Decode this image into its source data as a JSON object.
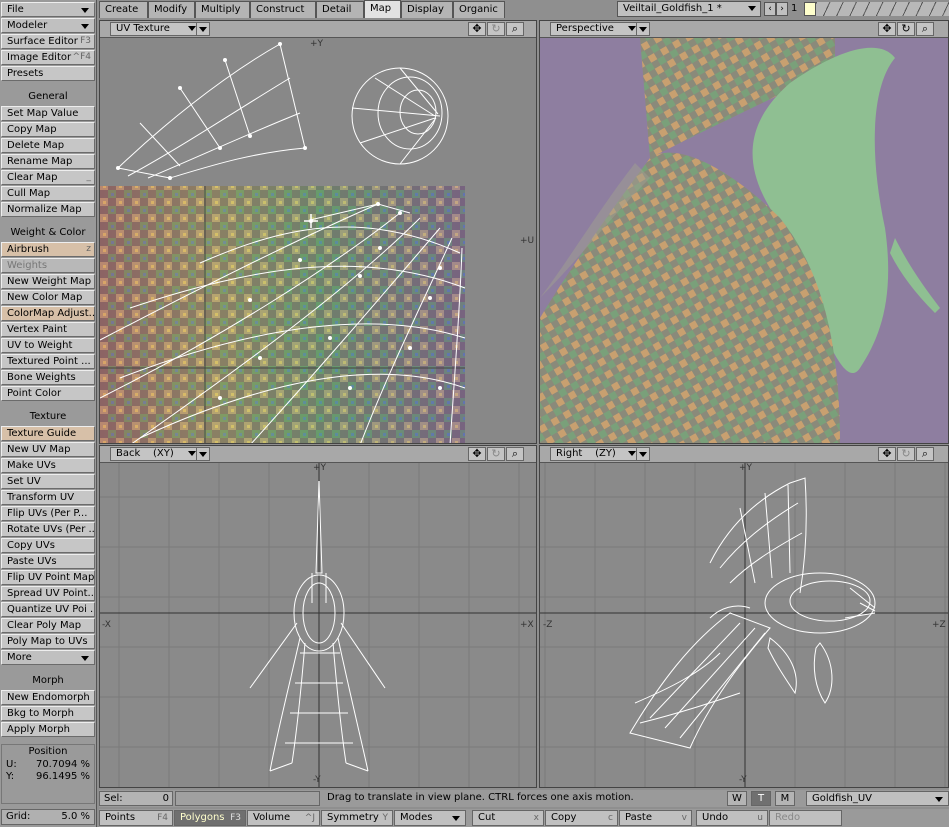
{
  "left": {
    "file": "File",
    "modeler": "Modeler",
    "items": [
      {
        "label": "Surface Editor",
        "sc": "F3"
      },
      {
        "label": "Image Editor",
        "sc": "^F4"
      },
      {
        "label": "Presets",
        "sc": ""
      }
    ],
    "general": "General",
    "general_items": [
      {
        "label": "Set Map Value",
        "sc": ""
      },
      {
        "label": "Copy Map",
        "sc": ""
      },
      {
        "label": "Delete Map",
        "sc": ""
      },
      {
        "label": "Rename Map",
        "sc": ""
      },
      {
        "label": "Clear Map",
        "sc": "_"
      },
      {
        "label": "Cull Map",
        "sc": ""
      },
      {
        "label": "Normalize Map",
        "sc": ""
      }
    ],
    "weight": "Weight & Color",
    "weight_items": [
      {
        "label": "Airbrush",
        "sc": "z"
      },
      {
        "label": "Weights",
        "sc": ""
      },
      {
        "label": "New Weight Map",
        "sc": ""
      },
      {
        "label": "New Color Map",
        "sc": ""
      },
      {
        "label": "ColorMap Adjust...",
        "sc": ""
      },
      {
        "label": "Vertex Paint",
        "sc": ""
      },
      {
        "label": "UV to Weight",
        "sc": ""
      },
      {
        "label": "Textured Point ...",
        "sc": ""
      },
      {
        "label": "Bone Weights",
        "sc": ""
      },
      {
        "label": "Point Color",
        "sc": ""
      }
    ],
    "texture": "Texture",
    "texture_items": [
      {
        "label": "Texture Guide",
        "sc": ""
      },
      {
        "label": "New UV Map",
        "sc": ""
      },
      {
        "label": "Make UVs",
        "sc": ""
      },
      {
        "label": "Set UV",
        "sc": ""
      },
      {
        "label": "Transform UV",
        "sc": ""
      },
      {
        "label": "Flip UVs (Per P...",
        "sc": ""
      },
      {
        "label": "Rotate UVs (Per ...",
        "sc": ""
      },
      {
        "label": "Copy UVs",
        "sc": ""
      },
      {
        "label": "Paste UVs",
        "sc": ""
      },
      {
        "label": "Flip UV Point Map",
        "sc": ""
      },
      {
        "label": "Spread UV Point...",
        "sc": ""
      },
      {
        "label": "Quantize UV Poi ...",
        "sc": ""
      },
      {
        "label": "Clear Poly Map",
        "sc": ""
      },
      {
        "label": "Poly Map to UVs",
        "sc": ""
      }
    ],
    "more": "More",
    "morph": "Morph",
    "morph_items": [
      {
        "label": "New Endomorph",
        "sc": ""
      },
      {
        "label": "Bkg to Morph",
        "sc": ""
      },
      {
        "label": "Apply Morph",
        "sc": ""
      }
    ],
    "position_title": "Position",
    "u_label": "U:",
    "u_value": "70.7094 %",
    "v_label": "Y:",
    "v_value": "96.1495 %",
    "grid_label": "Grid:",
    "grid_value": "5.0 %"
  },
  "tabs": [
    "Create",
    "Modify",
    "Multiply",
    "Construct",
    "Detail",
    "Map",
    "Display",
    "Organic"
  ],
  "active_tab": "Map",
  "document": "Veiltail_Goldfish_1 *",
  "layer_num": "1",
  "viewports": {
    "tl": {
      "label": "UV Texture",
      "axis_top": "+Y",
      "axis_right": "+U"
    },
    "tr": {
      "label": "Perspective"
    },
    "bl": {
      "label": "Back",
      "view": "(XY)",
      "axis_top": "+Y",
      "axis_bottom": "-Y",
      "axis_left": "-X",
      "axis_right": "+X"
    },
    "br": {
      "label": "Right",
      "view": "(ZY)",
      "axis_top": "+Y",
      "axis_bottom": "-Y",
      "axis_left": "-Z",
      "axis_right": "+Z"
    }
  },
  "status": {
    "sel_label": "Sel:",
    "sel_value": "0",
    "message": "Drag to translate in view plane. CTRL forces one axis motion.",
    "w": "W",
    "t": "T",
    "m": "M",
    "map": "Goldfish_UV"
  },
  "toolbar": [
    {
      "label": "Points",
      "sc": "F4"
    },
    {
      "label": "Polygons",
      "sc": "F3"
    },
    {
      "label": "Volume",
      "sc": "^J"
    },
    {
      "label": "Symmetry",
      "sc": "Y"
    },
    {
      "label": "Modes",
      "sc": ""
    },
    {
      "label": "Cut",
      "sc": "x"
    },
    {
      "label": "Copy",
      "sc": "c"
    },
    {
      "label": "Paste",
      "sc": "v"
    },
    {
      "label": "Undo",
      "sc": "u"
    },
    {
      "label": "Redo",
      "sc": ""
    }
  ],
  "colors": {
    "perspective_bg": "#8e7ea0",
    "fish_green": "#8fbf92",
    "wire": "#ffffff"
  },
  "icons": [
    "move-icon",
    "rotate-icon",
    "zoom-icon"
  ]
}
